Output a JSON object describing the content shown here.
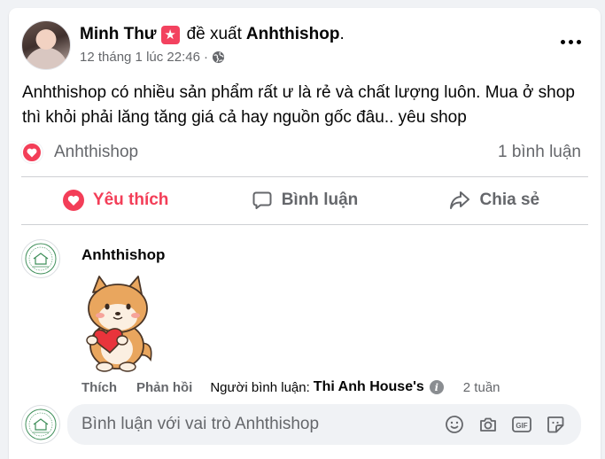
{
  "post": {
    "author": "Minh Thư",
    "recommends_text": "đề xuất",
    "page_name": "Anhthishop",
    "page_suffix": ".",
    "timestamp": "12 tháng 1 lúc 22:46",
    "separator": "·",
    "body": "Anhthishop có nhiều sản phẩm rất ư là rẻ và chất lượng luôn. Mua ở shop thì khỏi phải lăng tăng giá cả hay nguồn gốc đâu.. yêu shop"
  },
  "reactions": {
    "reactor": "Anhthishop",
    "comment_count": "1 bình luận"
  },
  "actions": {
    "like": "Yêu thích",
    "comment": "Bình luận",
    "share": "Chia sẻ"
  },
  "comment": {
    "author": "Anhthishop",
    "like_label": "Thích",
    "reply_label": "Phản hồi",
    "commenter_label": "Người bình luận:",
    "commenter_page": "Thi Anh House's",
    "time_ago": "2 tuần"
  },
  "composer": {
    "placeholder": "Bình luận với vai trò Anhthishop"
  },
  "colors": {
    "accent_red": "#f33e58",
    "text_secondary": "#65676b",
    "logo_green": "#3f8f5a"
  },
  "icons": [
    "more-icon",
    "globe-icon",
    "heart-icon",
    "comment-icon",
    "share-icon",
    "info-icon",
    "emoji-icon",
    "camera-icon",
    "gif-icon",
    "sticker-icon"
  ]
}
